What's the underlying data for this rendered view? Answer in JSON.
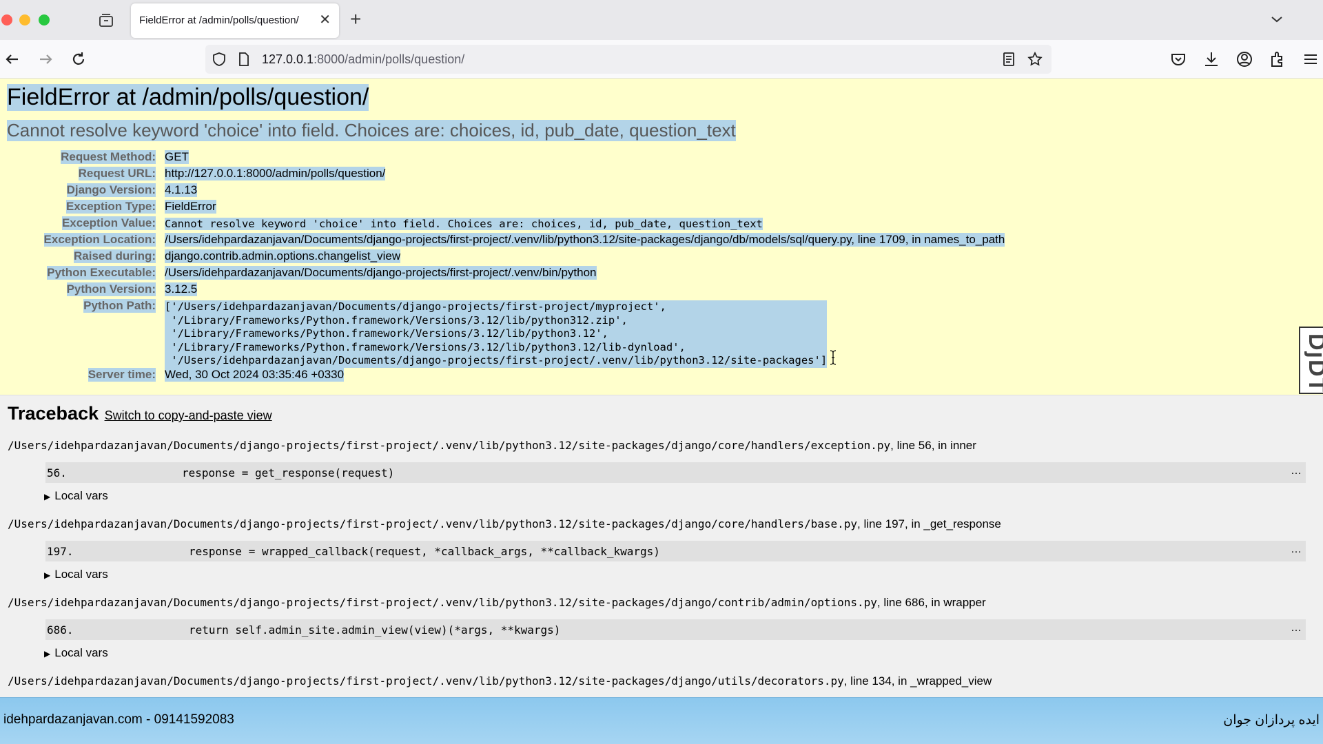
{
  "browser": {
    "tab_title": "FieldError at /admin/polls/question/",
    "url_host": "127.0.0.1",
    "url_rest": ":8000/admin/polls/question/"
  },
  "error": {
    "title": "FieldError at /admin/polls/question/",
    "subtitle": "Cannot resolve keyword 'choice' into field. Choices are: choices, id, pub_date, question_text"
  },
  "meta": [
    {
      "key": "Request Method:",
      "value": "GET"
    },
    {
      "key": "Request URL:",
      "value": "http://127.0.0.1:8000/admin/polls/question/"
    },
    {
      "key": "Django Version:",
      "value": "4.1.13"
    },
    {
      "key": "Exception Type:",
      "value": "FieldError"
    },
    {
      "key": "Exception Value:",
      "value": "Cannot resolve keyword 'choice' into field. Choices are: choices, id, pub_date, question_text"
    },
    {
      "key": "Exception Location:",
      "value": "/Users/idehpardazanjavan/Documents/django-projects/first-project/.venv/lib/python3.12/site-packages/django/db/models/sql/query.py, line 1709, in names_to_path"
    },
    {
      "key": "Raised during:",
      "value": "django.contrib.admin.options.changelist_view"
    },
    {
      "key": "Python Executable:",
      "value": "/Users/idehpardazanjavan/Documents/django-projects/first-project/.venv/bin/python"
    },
    {
      "key": "Python Version:",
      "value": "3.12.5"
    }
  ],
  "python_path": {
    "key": "Python Path:",
    "value": "['/Users/idehpardazanjavan/Documents/django-projects/first-project/myproject',\n '/Library/Frameworks/Python.framework/Versions/3.12/lib/python312.zip',\n '/Library/Frameworks/Python.framework/Versions/3.12/lib/python3.12',\n '/Library/Frameworks/Python.framework/Versions/3.12/lib/python3.12/lib-dynload',\n '/Users/idehpardazanjavan/Documents/django-projects/first-project/.venv/lib/python3.12/site-packages']"
  },
  "server_time": {
    "key": "Server time:",
    "value": "Wed, 30 Oct 2024 03:35:46 +0330"
  },
  "djdt_label": "DjDT",
  "traceback": {
    "title": "Traceback",
    "switch_link": "Switch to copy-and-paste view",
    "local_vars_label": "Local vars",
    "frames": [
      {
        "file": "/Users/idehpardazanjavan/Documents/django-projects/first-project/.venv/lib/python3.12/site-packages/django/core/handlers/exception.py",
        "suffix": ", line 56, in inner",
        "line_no": "56.",
        "code": "response = get_response(request)",
        "dots": "…"
      },
      {
        "file": "/Users/idehpardazanjavan/Documents/django-projects/first-project/.venv/lib/python3.12/site-packages/django/core/handlers/base.py",
        "suffix": ", line 197, in _get_response",
        "line_no": "197.",
        "code": "response = wrapped_callback(request, *callback_args, **callback_kwargs)",
        "dots": "…"
      },
      {
        "file": "/Users/idehpardazanjavan/Documents/django-projects/first-project/.venv/lib/python3.12/site-packages/django/contrib/admin/options.py",
        "suffix": ", line 686, in wrapper",
        "line_no": "686.",
        "code": "return self.admin_site.admin_view(view)(*args, **kwargs)",
        "dots": "…"
      },
      {
        "file": "/Users/idehpardazanjavan/Documents/django-projects/first-project/.venv/lib/python3.12/site-packages/django/utils/decorators.py",
        "suffix": ", line 134, in _wrapped_view"
      }
    ]
  },
  "footer": {
    "left": "idehpardazanjavan.com - 09141592083",
    "right": "ایده پردازان جوان"
  }
}
